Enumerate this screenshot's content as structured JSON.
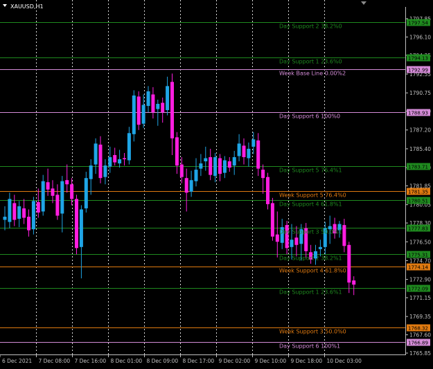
{
  "symbol_label": "XAUUSD,H1",
  "colors": {
    "background": "#000000",
    "axis": "#c0c0c0",
    "grid": "#ffffff",
    "bull": "#1fa5e6",
    "bear": "#ff1ee0",
    "green_level": "#1f8a1f",
    "orange_level": "#e07a10",
    "violet_level": "#d58cd8"
  },
  "price_axis": {
    "ticks": [
      "1797.85",
      "1796.10",
      "1794.35",
      "1792.55",
      "1790.75",
      "1789.00",
      "1787.20",
      "1785.40",
      "1783.60",
      "1781.85",
      "1780.05",
      "1778.30",
      "1776.50",
      "1774.70",
      "1772.90",
      "1771.15",
      "1769.35",
      "1767.60",
      "1765.85"
    ]
  },
  "time_axis": {
    "labels": [
      "6 Dec 2021",
      "7 Dec 08:00",
      "7 Dec 16:00",
      "8 Dec 01:00",
      "8 Dec 09:00",
      "8 Dec 17:00",
      "9 Dec 02:00",
      "9 Dec 10:00",
      "9 Dec 18:00",
      "10 Dec 03:00"
    ]
  },
  "levels": [
    {
      "label": "Day Support 2 38.2%0",
      "price": 1797.54,
      "price_label": "1797.54",
      "color": "green"
    },
    {
      "label": "Day Support 1 23.6%0",
      "price": 1794.13,
      "price_label": "1794.13",
      "color": "green"
    },
    {
      "label": "Week Base Line 0.00%2",
      "price": 1792.99,
      "price_label": "1792.99",
      "color": "violet"
    },
    {
      "label": "Day Support 6 100%0",
      "price": 1788.93,
      "price_label": "1788.93",
      "color": "violet"
    },
    {
      "label": "Day Support 5 76.4%1",
      "price": 1783.71,
      "price_label": "1783.71",
      "color": "green"
    },
    {
      "label": "Week Support 5 76.4%0",
      "price": 1781.35,
      "price_label": "1781.35",
      "color": "orange"
    },
    {
      "label": "Day Support 4 61.8%1",
      "price": 1780.51,
      "price_label": "1780.51",
      "color": "green"
    },
    {
      "label": "Day Support 3 50.0%1",
      "price": 1777.83,
      "price_label": "1777.83",
      "color": "green"
    },
    {
      "label": "Day Support 2 38.2%1",
      "price": 1775.31,
      "price_label": "1775.31",
      "color": "green"
    },
    {
      "label": "Week Support 4 61.8%0",
      "price": 1774.14,
      "price_label": "1774.14",
      "color": "orange"
    },
    {
      "label": "Day Support 1 23.6%1",
      "price": 1772.09,
      "price_label": "1772.09",
      "color": "green"
    },
    {
      "label": "Week Support 3 50.0%0",
      "price": 1768.32,
      "price_label": "1768.32",
      "color": "orange"
    },
    {
      "label": "Day Support 6 100%1",
      "price": 1766.89,
      "price_label": "1766.89",
      "color": "violet"
    }
  ],
  "chart_data": {
    "type": "candlestick",
    "symbol": "XAUUSD",
    "timeframe": "H1",
    "ylim": [
      1765.2,
      1799.2
    ],
    "candles": [
      {
        "o": 1778.6,
        "h": 1779.9,
        "l": 1777.6,
        "c": 1778.9
      },
      {
        "o": 1778.4,
        "h": 1781.2,
        "l": 1777.8,
        "c": 1780.6
      },
      {
        "o": 1780.2,
        "h": 1781.0,
        "l": 1778.0,
        "c": 1778.6
      },
      {
        "o": 1778.7,
        "h": 1780.4,
        "l": 1777.9,
        "c": 1779.9
      },
      {
        "o": 1779.7,
        "h": 1780.6,
        "l": 1778.2,
        "c": 1778.8
      },
      {
        "o": 1778.9,
        "h": 1779.6,
        "l": 1777.0,
        "c": 1777.6
      },
      {
        "o": 1777.7,
        "h": 1780.8,
        "l": 1777.2,
        "c": 1780.4
      },
      {
        "o": 1780.3,
        "h": 1781.6,
        "l": 1778.8,
        "c": 1779.3
      },
      {
        "o": 1779.4,
        "h": 1782.9,
        "l": 1779.0,
        "c": 1782.3
      },
      {
        "o": 1782.2,
        "h": 1783.5,
        "l": 1780.9,
        "c": 1781.5
      },
      {
        "o": 1781.6,
        "h": 1782.4,
        "l": 1780.2,
        "c": 1780.9
      },
      {
        "o": 1781.0,
        "h": 1782.0,
        "l": 1778.6,
        "c": 1779.0
      },
      {
        "o": 1779.2,
        "h": 1782.8,
        "l": 1777.4,
        "c": 1782.3
      },
      {
        "o": 1782.4,
        "h": 1783.9,
        "l": 1781.2,
        "c": 1782.0
      },
      {
        "o": 1782.0,
        "h": 1782.6,
        "l": 1780.0,
        "c": 1780.6
      },
      {
        "o": 1780.6,
        "h": 1781.0,
        "l": 1775.3,
        "c": 1775.9
      },
      {
        "o": 1776.0,
        "h": 1780.0,
        "l": 1773.0,
        "c": 1779.6
      },
      {
        "o": 1779.7,
        "h": 1783.2,
        "l": 1779.3,
        "c": 1782.6
      },
      {
        "o": 1782.5,
        "h": 1784.4,
        "l": 1781.0,
        "c": 1783.8
      },
      {
        "o": 1783.9,
        "h": 1786.4,
        "l": 1783.0,
        "c": 1785.9
      },
      {
        "o": 1785.8,
        "h": 1786.6,
        "l": 1782.1,
        "c": 1782.6
      },
      {
        "o": 1782.7,
        "h": 1784.4,
        "l": 1782.0,
        "c": 1783.8
      },
      {
        "o": 1783.7,
        "h": 1785.6,
        "l": 1783.1,
        "c": 1784.6
      },
      {
        "o": 1784.8,
        "h": 1785.5,
        "l": 1783.8,
        "c": 1784.1
      },
      {
        "o": 1784.0,
        "h": 1785.3,
        "l": 1783.6,
        "c": 1784.4
      },
      {
        "o": 1784.5,
        "h": 1785.0,
        "l": 1783.8,
        "c": 1784.4
      },
      {
        "o": 1784.3,
        "h": 1787.5,
        "l": 1783.9,
        "c": 1786.9
      },
      {
        "o": 1786.8,
        "h": 1791.0,
        "l": 1786.1,
        "c": 1790.5
      },
      {
        "o": 1790.4,
        "h": 1790.9,
        "l": 1787.2,
        "c": 1787.7
      },
      {
        "o": 1787.8,
        "h": 1790.6,
        "l": 1787.4,
        "c": 1789.6
      },
      {
        "o": 1789.5,
        "h": 1791.4,
        "l": 1788.9,
        "c": 1790.9
      },
      {
        "o": 1790.6,
        "h": 1791.3,
        "l": 1788.3,
        "c": 1788.9
      },
      {
        "o": 1789.2,
        "h": 1790.1,
        "l": 1787.6,
        "c": 1789.7
      },
      {
        "o": 1789.8,
        "h": 1790.3,
        "l": 1787.9,
        "c": 1788.9
      },
      {
        "o": 1789.1,
        "h": 1792.3,
        "l": 1788.6,
        "c": 1791.4
      },
      {
        "o": 1791.8,
        "h": 1792.6,
        "l": 1784.8,
        "c": 1786.4
      },
      {
        "o": 1786.5,
        "h": 1787.0,
        "l": 1783.0,
        "c": 1783.8
      },
      {
        "o": 1783.9,
        "h": 1784.6,
        "l": 1782.1,
        "c": 1782.7
      },
      {
        "o": 1782.6,
        "h": 1783.5,
        "l": 1779.4,
        "c": 1781.2
      },
      {
        "o": 1781.3,
        "h": 1783.3,
        "l": 1780.8,
        "c": 1782.4
      },
      {
        "o": 1782.3,
        "h": 1784.5,
        "l": 1781.8,
        "c": 1783.4
      },
      {
        "o": 1783.5,
        "h": 1784.9,
        "l": 1782.8,
        "c": 1784.0
      },
      {
        "o": 1784.2,
        "h": 1785.6,
        "l": 1783.3,
        "c": 1784.5
      },
      {
        "o": 1784.6,
        "h": 1785.4,
        "l": 1782.4,
        "c": 1782.9
      },
      {
        "o": 1782.8,
        "h": 1785.0,
        "l": 1782.2,
        "c": 1784.6
      },
      {
        "o": 1784.5,
        "h": 1784.9,
        "l": 1782.3,
        "c": 1783.0
      },
      {
        "o": 1783.1,
        "h": 1784.7,
        "l": 1782.6,
        "c": 1784.3
      },
      {
        "o": 1784.2,
        "h": 1784.6,
        "l": 1783.2,
        "c": 1783.6
      },
      {
        "o": 1783.8,
        "h": 1785.2,
        "l": 1782.9,
        "c": 1784.6
      },
      {
        "o": 1784.7,
        "h": 1786.8,
        "l": 1784.2,
        "c": 1785.9
      },
      {
        "o": 1785.7,
        "h": 1786.4,
        "l": 1783.9,
        "c": 1784.6
      },
      {
        "o": 1784.5,
        "h": 1786.0,
        "l": 1783.7,
        "c": 1785.4
      },
      {
        "o": 1785.6,
        "h": 1787.0,
        "l": 1784.9,
        "c": 1786.3
      },
      {
        "o": 1786.2,
        "h": 1786.9,
        "l": 1782.8,
        "c": 1783.5
      },
      {
        "o": 1783.4,
        "h": 1783.9,
        "l": 1781.1,
        "c": 1782.6
      },
      {
        "o": 1782.7,
        "h": 1783.1,
        "l": 1779.6,
        "c": 1780.1
      },
      {
        "o": 1780.2,
        "h": 1780.7,
        "l": 1776.6,
        "c": 1777.0
      },
      {
        "o": 1777.2,
        "h": 1779.4,
        "l": 1775.0,
        "c": 1776.5
      },
      {
        "o": 1776.4,
        "h": 1778.7,
        "l": 1775.8,
        "c": 1777.9
      },
      {
        "o": 1778.1,
        "h": 1778.5,
        "l": 1775.3,
        "c": 1775.9
      },
      {
        "o": 1776.0,
        "h": 1778.2,
        "l": 1774.8,
        "c": 1776.7
      },
      {
        "o": 1776.9,
        "h": 1778.0,
        "l": 1775.1,
        "c": 1776.2
      },
      {
        "o": 1776.3,
        "h": 1778.2,
        "l": 1774.7,
        "c": 1777.7
      },
      {
        "o": 1777.8,
        "h": 1778.3,
        "l": 1775.0,
        "c": 1775.6
      },
      {
        "o": 1775.5,
        "h": 1776.2,
        "l": 1774.4,
        "c": 1774.8
      },
      {
        "o": 1774.9,
        "h": 1776.2,
        "l": 1774.3,
        "c": 1775.6
      },
      {
        "o": 1775.8,
        "h": 1776.7,
        "l": 1775.1,
        "c": 1776.0
      },
      {
        "o": 1776.0,
        "h": 1778.4,
        "l": 1775.3,
        "c": 1777.8
      },
      {
        "o": 1777.7,
        "h": 1779.0,
        "l": 1776.3,
        "c": 1778.0
      },
      {
        "o": 1778.2,
        "h": 1778.8,
        "l": 1776.8,
        "c": 1777.3
      },
      {
        "o": 1777.6,
        "h": 1778.5,
        "l": 1776.9,
        "c": 1778.2
      },
      {
        "o": 1778.1,
        "h": 1778.7,
        "l": 1775.5,
        "c": 1776.1
      },
      {
        "o": 1776.2,
        "h": 1776.5,
        "l": 1771.6,
        "c": 1772.6
      },
      {
        "o": 1772.8,
        "h": 1773.2,
        "l": 1771.4,
        "c": 1772.4
      }
    ]
  }
}
